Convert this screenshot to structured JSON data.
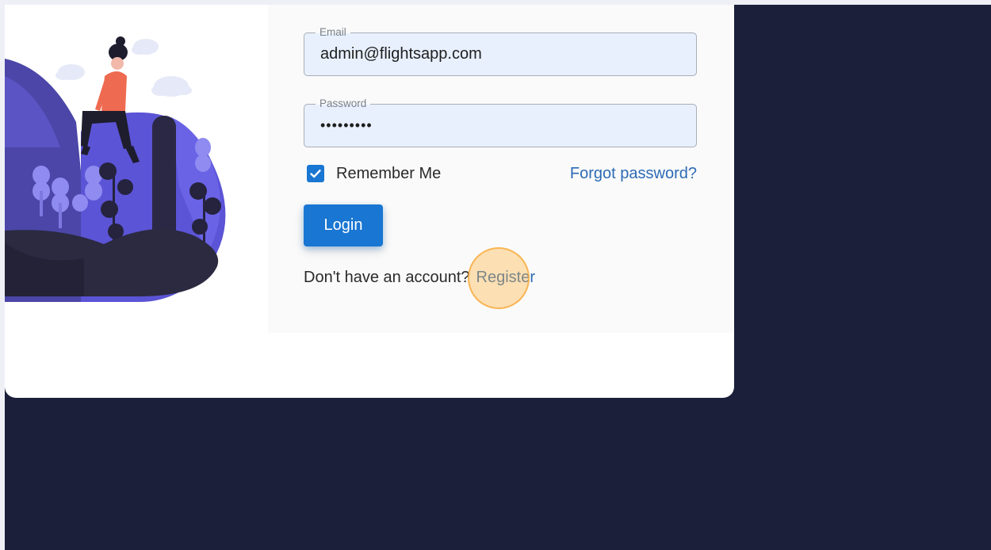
{
  "login_form": {
    "email": {
      "label": "Email",
      "value": "admin@flightsapp.com"
    },
    "password": {
      "label": "Password",
      "value": "•••••••••"
    },
    "remember_me": {
      "label": "Remember Me",
      "checked": true
    },
    "forgot_password": "Forgot password?",
    "login_button": "Login",
    "register_prompt": "Don't have an account?",
    "register_link": "Register"
  },
  "colors": {
    "primary": "#1976d2",
    "link": "#2c6bb5",
    "page_background": "#1b1f3a",
    "input_background": "#e8f0fe",
    "click_highlight": "#ffb240"
  }
}
